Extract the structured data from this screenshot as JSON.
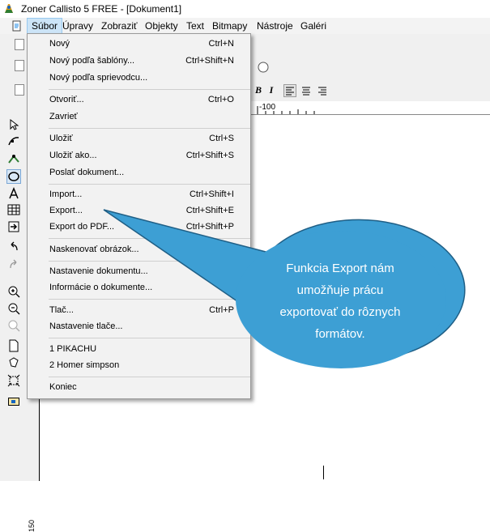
{
  "window": {
    "title": "Zoner Callisto 5 FREE - [Dokument1]"
  },
  "menubar": {
    "items": [
      {
        "label": "Súbor"
      },
      {
        "label": "Úpravy"
      },
      {
        "label": "Zobraziť"
      },
      {
        "label": "Objekty"
      },
      {
        "label": "Text"
      },
      {
        "label": "Bitmapy"
      },
      {
        "label": "Nástroje"
      },
      {
        "label": "Galéri"
      }
    ]
  },
  "file_menu": {
    "items": [
      {
        "label": "Nový",
        "shortcut": "Ctrl+N"
      },
      {
        "label": "Nový podľa šablóny...",
        "shortcut": "Ctrl+Shift+N"
      },
      {
        "label": "Nový podľa sprievodcu...",
        "shortcut": ""
      },
      {
        "label": "Otvoriť...",
        "shortcut": "Ctrl+O"
      },
      {
        "label": "Zavrieť",
        "shortcut": ""
      },
      {
        "label": "Uložiť",
        "shortcut": "Ctrl+S"
      },
      {
        "label": "Uložiť ako...",
        "shortcut": "Ctrl+Shift+S"
      },
      {
        "label": "Poslať dokument...",
        "shortcut": ""
      },
      {
        "label": "Import...",
        "shortcut": "Ctrl+Shift+I"
      },
      {
        "label": "Export...",
        "shortcut": "Ctrl+Shift+E"
      },
      {
        "label": "Export do PDF...",
        "shortcut": "Ctrl+Shift+P"
      },
      {
        "label": "Naskenovať obrázok...",
        "shortcut": ""
      },
      {
        "label": "Nastavenie dokumentu...",
        "shortcut": "Ctr"
      },
      {
        "label": "Informácie o dokumente...",
        "shortcut": ""
      },
      {
        "label": "Tlač...",
        "shortcut": "Ctrl+P"
      },
      {
        "label": "Nastavenie tlače...",
        "shortcut": ""
      },
      {
        "label": "1 PIKACHU",
        "shortcut": ""
      },
      {
        "label": "2 Homer simpson",
        "shortcut": ""
      },
      {
        "label": "Koniec",
        "shortcut": ""
      }
    ]
  },
  "callout": {
    "lines": [
      "Funkcia Export nám",
      "umožňuje prácu",
      "exportovať do rôznych",
      "formátov."
    ],
    "fill": "#3d9fd4",
    "stroke": "#1f5f86"
  },
  "ruler": {
    "horizontal_label": "-100",
    "vertical_label": "150"
  },
  "format_buttons": {
    "bold": "B",
    "italic": "I"
  }
}
